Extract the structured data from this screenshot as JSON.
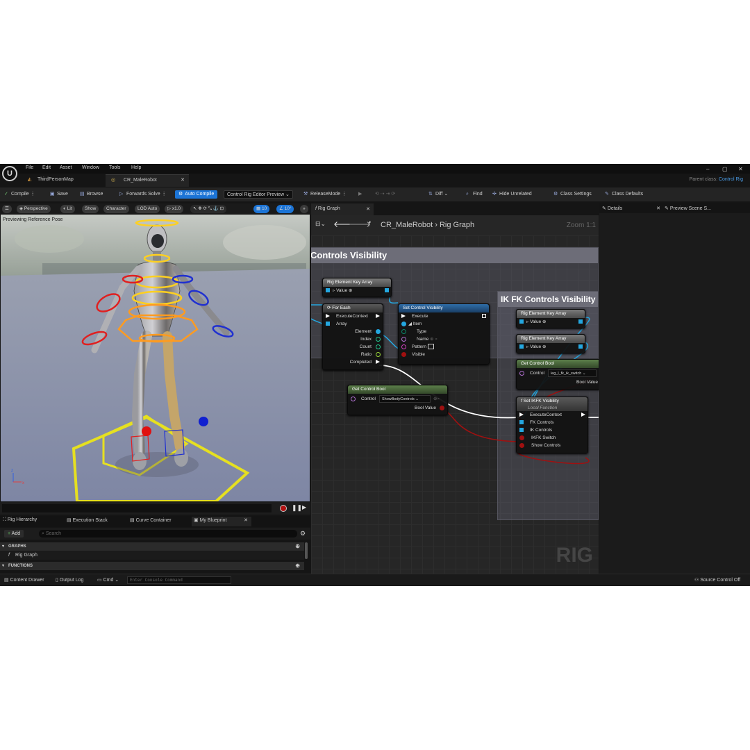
{
  "menu": [
    "File",
    "Edit",
    "Asset",
    "Window",
    "Tools",
    "Help"
  ],
  "tabs": [
    {
      "label": "ThirdPersonMap"
    },
    {
      "label": "CR_MaleRobot"
    }
  ],
  "parent_class": {
    "label": "Parent class:",
    "value": "Control Rig"
  },
  "toolbar": {
    "compile": "Compile",
    "save": "Save",
    "browse": "Browse",
    "forwards_solve": "Forwards Solve",
    "auto_compile": "Auto Compile",
    "preview_dropdown": "Control Rig Editor Preview",
    "release_mode": "ReleaseMode",
    "diff": "Diff",
    "find": "Find",
    "hide_unrelated": "Hide Unrelated",
    "class_settings": "Class Settings",
    "class_defaults": "Class Defaults"
  },
  "viewport": {
    "perspective": "Perspective",
    "lit": "Lit",
    "show": "Show",
    "character": "Character",
    "lod": "LOD Auto",
    "speed": "x1.0",
    "grid_snap": "10",
    "rot_snap": "10°",
    "status": "Previewing Reference Pose"
  },
  "bottom_tabs": [
    "Rig Hierarchy",
    "Execution Stack",
    "Curve Container",
    "My Blueprint"
  ],
  "my_blueprint": {
    "add_label": "Add",
    "search_placeholder": "Search",
    "graphs_header": "GRAPHS",
    "graph_item": "Rig Graph",
    "functions_header": "FUNCTIONS"
  },
  "graph": {
    "tab_label": "Rig Graph",
    "breadcrumb_asset": "CR_MaleRobot",
    "breadcrumb_graph": "Rig Graph",
    "zoom": "Zoom 1:1",
    "watermark": "RIG",
    "comment1_title": "Controls Visibility",
    "comment2_title": "IK FK Controls Visibility",
    "nodes": {
      "key_array_1": {
        "title": "Rig Element Key Array",
        "pin": "Value"
      },
      "for_each": {
        "title": "For Each",
        "pins": [
          "ExecuteContext",
          "Array"
        ],
        "outputs": [
          "Element",
          "Index",
          "Count",
          "Ratio",
          "Completed"
        ]
      },
      "set_control_visibility": {
        "title": "Set Control Visibility",
        "pins": [
          "Execute",
          "Item",
          "Type",
          "Name",
          "Pattern",
          "Visible"
        ]
      },
      "get_control_bool_1": {
        "title": "Get Control Bool",
        "control_label": "Control",
        "control_value": "ShowBodyControls",
        "output": "Bool Value"
      },
      "key_array_2": {
        "title": "Rig Element Key Array",
        "pin": "Value"
      },
      "key_array_3": {
        "title": "Rig Element Key Array",
        "pin": "Value"
      },
      "get_control_bool_2": {
        "title": "Get Control Bool",
        "control_label": "Control",
        "control_value": "leg_l_fk_ik_switch",
        "output": "Bool Value"
      },
      "set_ikfk": {
        "title": "Set IKFK Visibility",
        "subtitle": "Local Function",
        "pins": [
          "ExecuteContext",
          "FK Controls",
          "IK Controls",
          "IKFK Switch",
          "Show Controls"
        ]
      }
    }
  },
  "details_tabs": [
    "Details",
    "Preview Scene S..."
  ],
  "status_bar": {
    "content_drawer": "Content Drawer",
    "output_log": "Output Log",
    "cmd": "Cmd",
    "console_placeholder": "Enter Console Command",
    "source_control": "Source Control Off"
  },
  "colors": {
    "accent": "#1c74d6",
    "exec": "#ffffff",
    "struct": "#24a7e0",
    "bool": "#a01010",
    "name": "#b070d0"
  }
}
